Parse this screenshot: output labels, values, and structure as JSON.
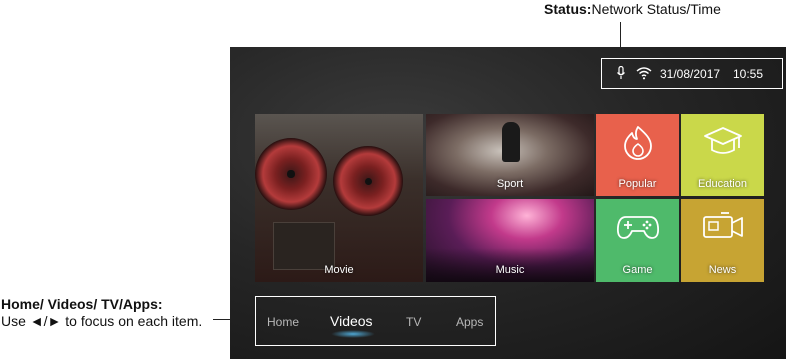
{
  "callouts": {
    "status_title": "Status:",
    "status_text": "Network Status/Time",
    "home_title": "Home/ Videos/ TV/Apps:",
    "home_text": "Use ◄/► to focus on each item."
  },
  "status_bar": {
    "date": "31/08/2017",
    "time": "10:55",
    "icons": [
      "microphone-icon",
      "wifi-icon"
    ]
  },
  "tiles": {
    "movie": "Movie",
    "sport": "Sport",
    "music": "Music",
    "popular": "Popular",
    "education": "Education",
    "game": "Game",
    "news": "News"
  },
  "nav": {
    "home": "Home",
    "videos": "Videos",
    "tv": "TV",
    "apps": "Apps",
    "active": "Videos"
  },
  "colors": {
    "popular": "#e8614c",
    "education": "#cad84a",
    "game": "#4fba6b",
    "news": "#c7a433",
    "active_glow": "#5ac8ff"
  }
}
